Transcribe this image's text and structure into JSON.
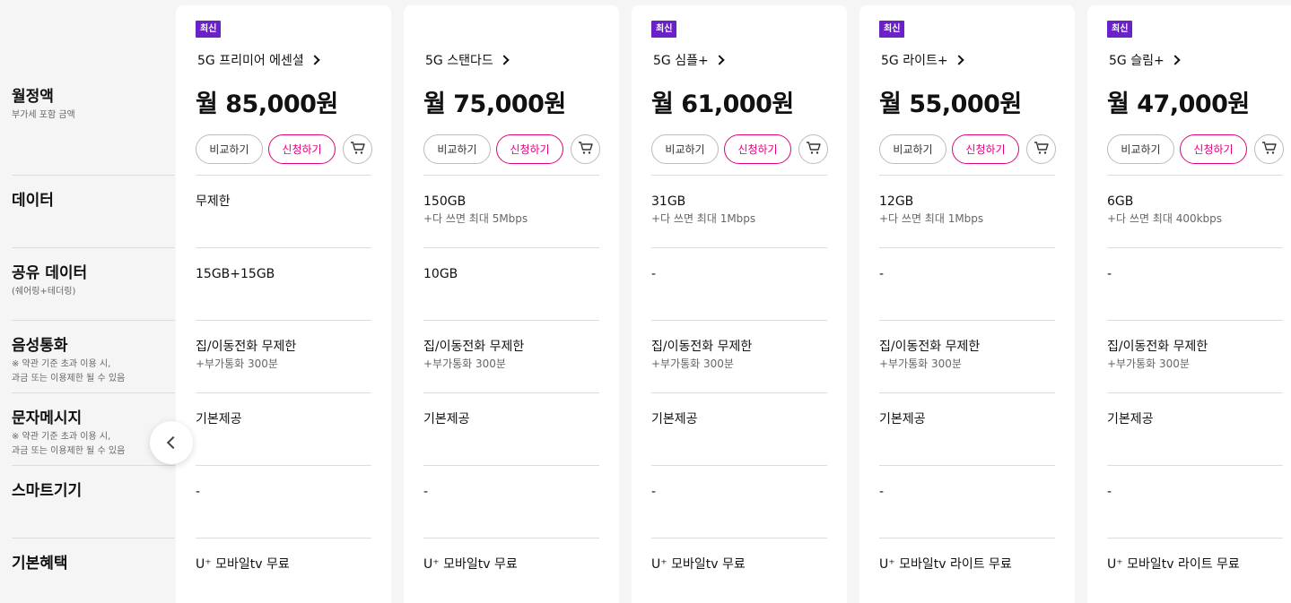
{
  "labels": [
    {
      "title": "월정액",
      "sub": [
        "부가세 포함 금액"
      ]
    },
    {
      "title": "데이터",
      "sub": []
    },
    {
      "title": "공유 데이터",
      "sub": [
        "(쉐어링+테더링)"
      ]
    },
    {
      "title": "음성통화",
      "sub": [
        "※ 약관 기준 초과 이용 시,",
        "과금 또는 이용제한 될 수 있음"
      ]
    },
    {
      "title": "문자메시지",
      "sub": [
        "※ 약관 기준 초과 이용 시,",
        "과금 또는 이용제한 될 수 있음"
      ]
    },
    {
      "title": "스마트기기",
      "sub": []
    },
    {
      "title": "기본혜택",
      "sub": []
    }
  ],
  "buttons": {
    "compare": "비교하기",
    "apply": "신청하기"
  },
  "colors": {
    "badge": "#6b21c8",
    "apply": "#e6007e"
  },
  "plans": [
    {
      "badge": "최신",
      "name": "5G 프리미어 에센셜",
      "price": "월 85,000원",
      "data": {
        "main": "무제한",
        "extra": ""
      },
      "share": {
        "main": "15GB+15GB",
        "extra": ""
      },
      "voice": {
        "main": "집/이동전화 무제한",
        "extra": "+부가통화 300분"
      },
      "sms": {
        "main": "기본제공",
        "extra": ""
      },
      "smart": {
        "main": "-",
        "extra": ""
      },
      "benefit": {
        "main": "U⁺ 모바일tv 무료",
        "extra": ""
      }
    },
    {
      "badge": "",
      "name": "5G 스탠다드",
      "price": "월 75,000원",
      "data": {
        "main": "150GB",
        "extra": "+다 쓰면 최대 5Mbps"
      },
      "share": {
        "main": "10GB",
        "extra": ""
      },
      "voice": {
        "main": "집/이동전화 무제한",
        "extra": "+부가통화 300분"
      },
      "sms": {
        "main": "기본제공",
        "extra": ""
      },
      "smart": {
        "main": "-",
        "extra": ""
      },
      "benefit": {
        "main": "U⁺ 모바일tv 무료",
        "extra": ""
      }
    },
    {
      "badge": "최신",
      "name": "5G 심플+",
      "price": "월 61,000원",
      "data": {
        "main": "31GB",
        "extra": "+다 쓰면 최대 1Mbps"
      },
      "share": {
        "main": "-",
        "extra": ""
      },
      "voice": {
        "main": "집/이동전화 무제한",
        "extra": "+부가통화 300분"
      },
      "sms": {
        "main": "기본제공",
        "extra": ""
      },
      "smart": {
        "main": "-",
        "extra": ""
      },
      "benefit": {
        "main": "U⁺ 모바일tv 무료",
        "extra": ""
      }
    },
    {
      "badge": "최신",
      "name": "5G 라이트+",
      "price": "월 55,000원",
      "data": {
        "main": "12GB",
        "extra": "+다 쓰면 최대 1Mbps"
      },
      "share": {
        "main": "-",
        "extra": ""
      },
      "voice": {
        "main": "집/이동전화 무제한",
        "extra": "+부가통화 300분"
      },
      "sms": {
        "main": "기본제공",
        "extra": ""
      },
      "smart": {
        "main": "-",
        "extra": ""
      },
      "benefit": {
        "main": "U⁺ 모바일tv 라이트 무료",
        "extra": ""
      }
    },
    {
      "badge": "최신",
      "name": "5G 슬림+",
      "price": "월 47,000원",
      "data": {
        "main": "6GB",
        "extra": "+다 쓰면 최대 400kbps"
      },
      "share": {
        "main": "-",
        "extra": ""
      },
      "voice": {
        "main": "집/이동전화 무제한",
        "extra": "+부가통화 300분"
      },
      "sms": {
        "main": "기본제공",
        "extra": ""
      },
      "smart": {
        "main": "-",
        "extra": ""
      },
      "benefit": {
        "main": "U⁺ 모바일tv 라이트 무료",
        "extra": ""
      }
    }
  ]
}
